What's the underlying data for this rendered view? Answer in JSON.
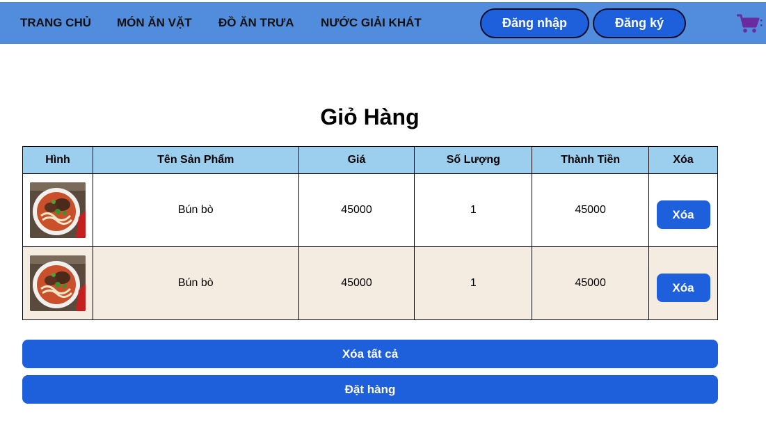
{
  "nav": {
    "items": [
      {
        "label": "TRANG CHỦ"
      },
      {
        "label": "MÓN ĂN VẶT"
      },
      {
        "label": "ĐỒ ĂN TRƯA"
      },
      {
        "label": "NƯỚC GIẢI KHÁT"
      }
    ],
    "login_label": "Đăng nhập",
    "register_label": "Đăng ký",
    "cart_icon": "shopping-cart-icon",
    "cart_color": "#6a2aa0"
  },
  "cart": {
    "title": "Giỏ Hàng",
    "columns": [
      "Hình",
      "Tên Sản Phẩm",
      "Giá",
      "Số Lượng",
      "Thành Tiền",
      "Xóa"
    ],
    "rows": [
      {
        "image_icon": "food-image",
        "name": "Bún bò",
        "price": "45000",
        "quantity": "1",
        "total": "45000",
        "delete_label": "Xóa"
      },
      {
        "image_icon": "food-image",
        "name": "Bún bò",
        "price": "45000",
        "quantity": "1",
        "total": "45000",
        "delete_label": "Xóa"
      }
    ],
    "clear_all_label": "Xóa tất cả",
    "order_label": "Đặt hàng"
  },
  "colors": {
    "header_bg": "#528cdc",
    "button_bg": "#1e5fdc",
    "table_header_bg": "#9ccfee",
    "alt_row_bg": "#f4ece0"
  }
}
